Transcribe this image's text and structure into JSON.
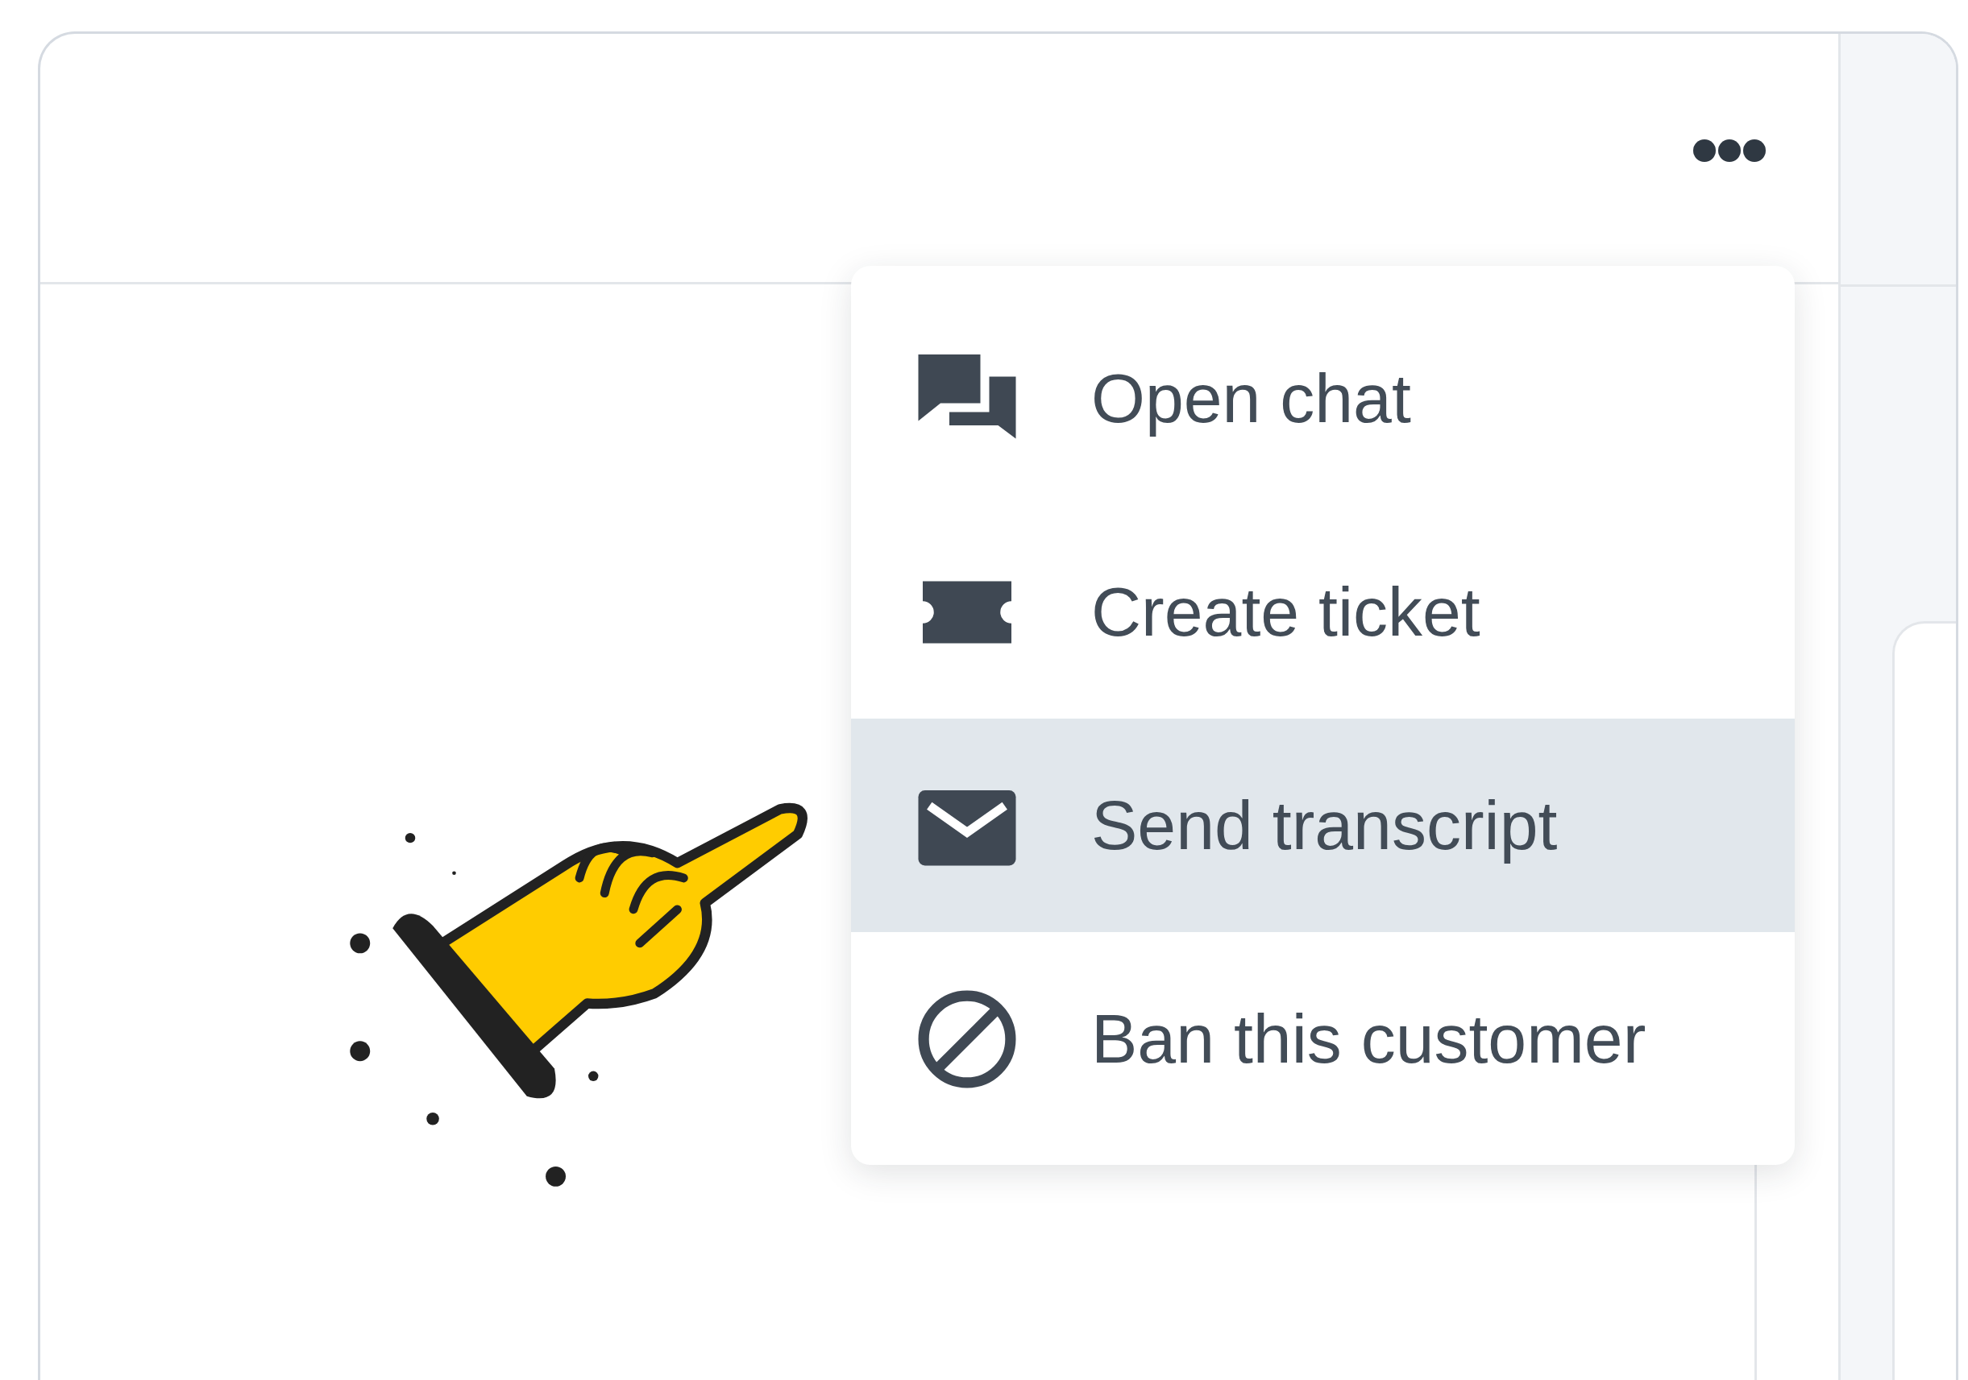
{
  "menu": {
    "items": [
      {
        "label": "Open chat",
        "selected": false
      },
      {
        "label": "Create ticket",
        "selected": false
      },
      {
        "label": "Send transcript",
        "selected": true
      },
      {
        "label": "Ban this customer",
        "selected": false
      }
    ]
  }
}
